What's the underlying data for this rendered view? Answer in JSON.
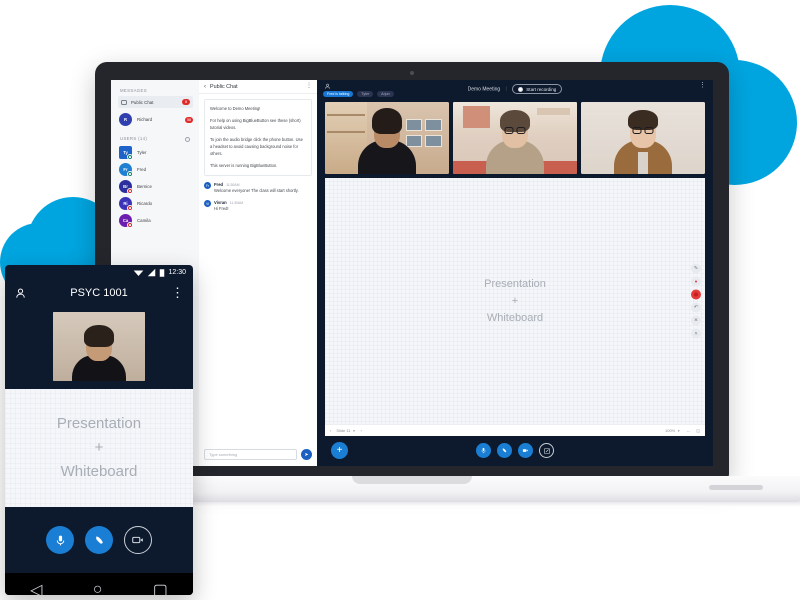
{
  "brand": {
    "accent": "#00A5E0",
    "blue": "#1a7fd4",
    "dark": "#0d1a2d",
    "red": "#e02b2b"
  },
  "laptop": {
    "users_panel": {
      "messages_label": "MESSAGES",
      "chats": [
        {
          "name": "Public Chat",
          "badge": "8",
          "icon": "chat-bubble-icon"
        },
        {
          "name": "Richard",
          "badge": "58",
          "initials": "R",
          "color": "#2f3fae"
        }
      ],
      "users_label": "USERS (14)",
      "settings_icon": "gear-icon",
      "users": [
        {
          "name": "Tyler",
          "initials": "Ty",
          "color": "#1d63c9",
          "shape": "square",
          "status": "live"
        },
        {
          "name": "Fred",
          "initials": "Fr",
          "color": "#1f7fd0",
          "shape": "circle",
          "status": "live"
        },
        {
          "name": "Bernice",
          "initials": "Br",
          "color": "#2c2f9e",
          "shape": "circle",
          "status": "muted"
        },
        {
          "name": "Ricardo",
          "initials": "Ri",
          "color": "#3b33b8",
          "shape": "circle",
          "status": "muted"
        },
        {
          "name": "Camila",
          "initials": "Ca",
          "color": "#6a1fae",
          "shape": "circle",
          "status": "muted"
        }
      ]
    },
    "chat_panel": {
      "back_icon": "chevron-left-icon",
      "title": "Public Chat",
      "menu_icon": "kebab-menu-icon",
      "welcome": [
        "Welcome to Demo Meeting!",
        "For help on using BigBlueButton see these (short) tutorial videos.",
        "To join the audio bridge click the phone button. Use a headset to avoid causing background noise for others.",
        "This server is running BigBlueButton."
      ],
      "messages": [
        {
          "author": "Fred",
          "initials": "Fr",
          "time": "11:30AM",
          "text": "Welcome everyone! The class will start shortly."
        },
        {
          "author": "Vivran",
          "initials": "Vi",
          "time": "11:30AM",
          "text": "Hi Fred!"
        }
      ],
      "input_placeholder": "Type something",
      "send_icon": "send-icon"
    },
    "meeting": {
      "manage_users_icon": "manage-users-icon",
      "title": "Demo Meeting",
      "record_label": "Start recording",
      "record_icon": "record-dot-icon",
      "options_icon": "kebab-menu-icon",
      "talking_pills": [
        {
          "label": "Fred is talking",
          "state": "talking"
        },
        {
          "label": "Tyler",
          "state": "idle"
        },
        {
          "label": "Arjun",
          "state": "idle"
        }
      ],
      "videos": [
        {
          "name": "webcam-tile-1"
        },
        {
          "name": "webcam-tile-2"
        },
        {
          "name": "webcam-tile-3"
        }
      ],
      "whiteboard": {
        "line1": "Presentation",
        "line2": "+",
        "line3": "Whiteboard",
        "tools": [
          {
            "name": "pen-tool",
            "glyph": "✎"
          },
          {
            "name": "thickness-tool",
            "glyph": "dot"
          },
          {
            "name": "color-tool",
            "glyph": "color"
          },
          {
            "name": "undo-tool",
            "glyph": "↶"
          },
          {
            "name": "clear-tool",
            "glyph": "✕"
          },
          {
            "name": "multiuser-tool",
            "glyph": "❐"
          }
        ],
        "prev_icon": "chevron-left-icon",
        "next_icon": "chevron-right-icon",
        "slide_label": "Slide 11",
        "zoom_label": "100%",
        "fit_width_icon": "fit-width-icon",
        "fullscreen_icon": "fullscreen-icon"
      },
      "actions": {
        "add_icon": "plus-icon",
        "mic_icon": "microphone-icon",
        "audio_icon": "phone-icon",
        "camera_icon": "video-camera-icon",
        "present_icon": "presentation-icon"
      }
    }
  },
  "phone": {
    "status": {
      "time": "12:30",
      "wifi_icon": "wifi-icon",
      "signal_icon": "signal-icon",
      "battery_icon": "battery-icon"
    },
    "user_icon": "user-icon",
    "title": "PSYC 1001",
    "menu_icon": "kebab-menu-icon",
    "webcam": "webcam-tile-mobile",
    "whiteboard": {
      "line1": "Presentation",
      "line2": "+",
      "line3": "Whiteboard"
    },
    "actions": {
      "mic_icon": "microphone-icon",
      "audio_icon": "phone-icon",
      "camera_icon": "video-camera-icon"
    },
    "nav": {
      "back_icon": "android-back-icon",
      "home_icon": "android-home-icon",
      "recents_icon": "android-recents-icon"
    }
  }
}
